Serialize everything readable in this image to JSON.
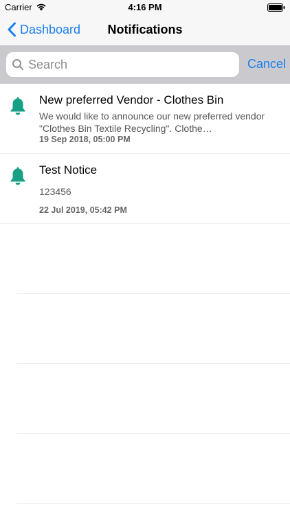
{
  "status_bar": {
    "carrier": "Carrier",
    "time": "4:16 PM",
    "icons": [
      "wifi-icon",
      "battery-icon"
    ]
  },
  "nav": {
    "back_label": "Dashboard",
    "title": "Notifications",
    "accent_color": "#1a7ef2"
  },
  "search": {
    "placeholder": "Search",
    "value": "",
    "cancel_label": "Cancel"
  },
  "notifications": [
    {
      "icon": "bell-icon",
      "title": "New preferred Vendor - Clothes Bin",
      "body": "We would like to announce our new preferred vendor \"Clothes Bin Textile Recycling\".  Clothe…",
      "date": "19 Sep 2018, 05:00 PM"
    },
    {
      "icon": "bell-icon",
      "title": "Test Notice",
      "body": "123456",
      "date": "22 Jul 2019, 05:42 PM"
    }
  ],
  "colors": {
    "bell": "#17a085",
    "search_bar_bg": "#c9c9ce",
    "nav_bg": "#f7f7f7"
  }
}
